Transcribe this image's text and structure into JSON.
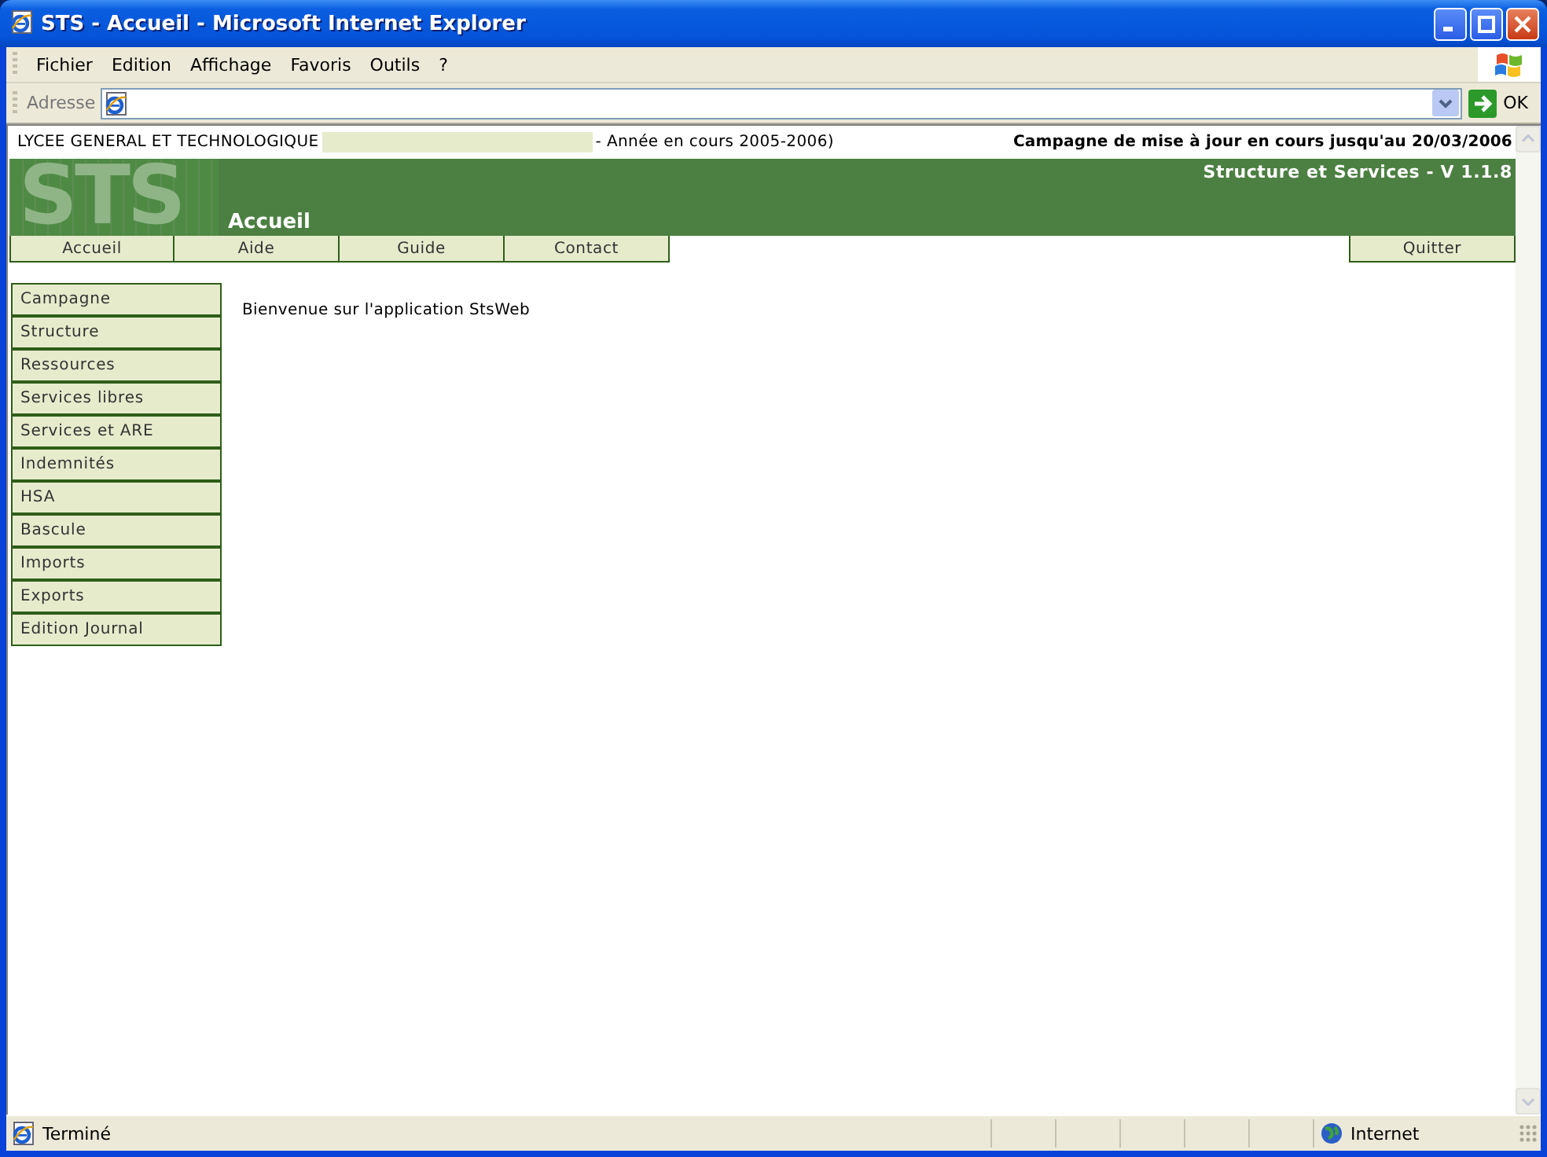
{
  "window": {
    "title": "STS - Accueil - Microsoft Internet Explorer"
  },
  "menu": [
    "Fichier",
    "Edition",
    "Affichage",
    "Favoris",
    "Outils",
    "?"
  ],
  "address_bar": {
    "label": "Adresse",
    "go_button": "OK"
  },
  "header": {
    "school": "LYCEE GENERAL ET TECHNOLOGIQUE",
    "year": "- Année en cours 2005-2006)",
    "campaign": "Campagne de mise à jour en cours jusqu'au 20/03/2006"
  },
  "banner": {
    "logo": "STS",
    "app_title": "Structure et Services - V 1.1.8",
    "page_title": "Accueil"
  },
  "nav": [
    "Accueil",
    "Aide",
    "Guide",
    "Contact"
  ],
  "quit_button": "Quitter",
  "sidebar": {
    "items": [
      "Campagne",
      "Structure",
      "Ressources",
      "Services libres",
      "Services et ARE",
      "Indemnités",
      "HSA",
      "Bascule",
      "Imports",
      "Exports",
      "Edition Journal"
    ]
  },
  "welcome": "Bienvenue sur l'application StsWeb",
  "status_bar": {
    "status": "Terminé",
    "zone": "Internet"
  }
}
